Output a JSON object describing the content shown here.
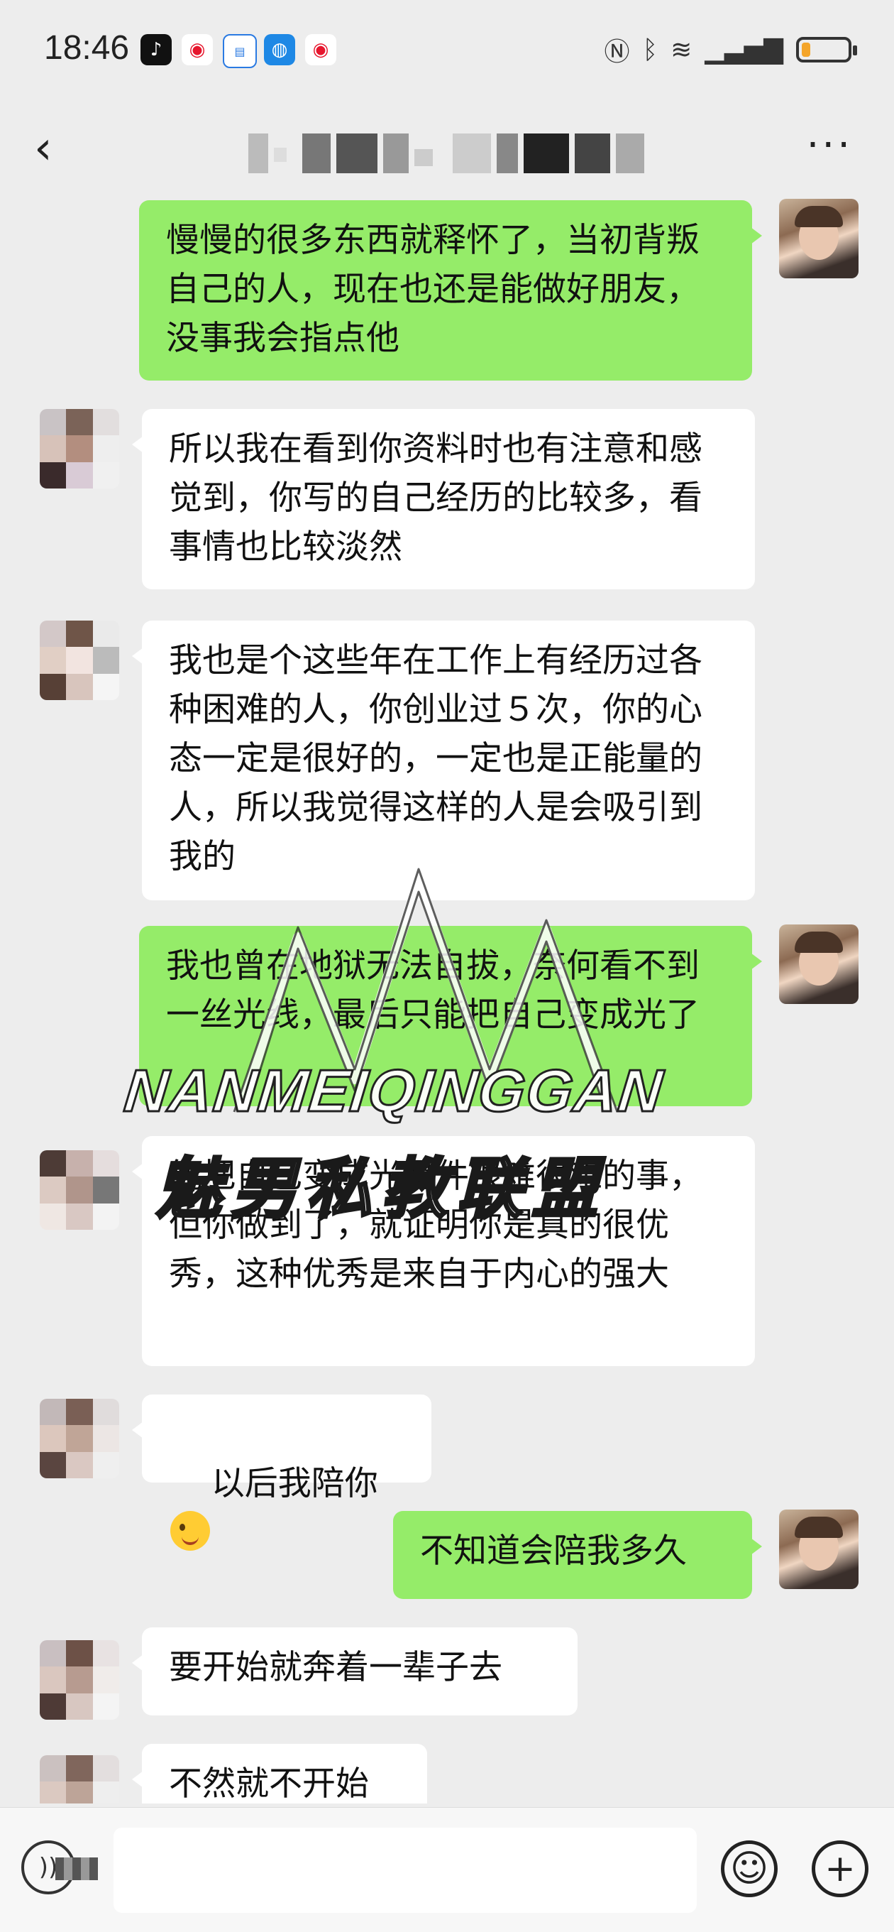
{
  "status_bar": {
    "time": "18:46",
    "app_icons": [
      "tiktok-icon",
      "weibo-icon",
      "news-app-icon",
      "browser-icon",
      "weibo-icon"
    ],
    "right_icons": [
      "nfc-icon",
      "bluetooth-icon",
      "wifi-icon",
      "signal-icon"
    ],
    "battery_level_percent": 20,
    "battery_color": "#f4a52a"
  },
  "header": {
    "back_glyph": "‹",
    "more_glyph": "···"
  },
  "colors": {
    "my_bubble": "#95ec69",
    "other_bubble": "#ffffff",
    "background": "#ededed"
  },
  "messages": [
    {
      "side": "me",
      "text": "慢慢的很多东西就释怀了，当初背叛自己的人，现在也还是能做好朋友，没事我会指点他"
    },
    {
      "side": "other",
      "text": "所以我在看到你资料时也有注意和感觉到，你写的自己经历的比较多，看事情也比较淡然"
    },
    {
      "side": "other",
      "text": "我也是个这些年在工作上有经历过各种困难的人，你创业过５次，你的心态一定是很好的，一定也是正能量的人，所以我觉得这样的人是会吸引到我的"
    },
    {
      "side": "me",
      "text": "我也曾在地狱无法自拔，奈何看不到一丝光线，最后只能把自己变成光了"
    },
    {
      "side": "other",
      "text": "能把自己变成光是件很难很难的事，但你做到了，就证明你是真的很优秀，这种优秀是来自于内心的强大"
    },
    {
      "side": "other",
      "text": "以后我陪你",
      "emoji": "winking-face-with-tongue-emoji"
    },
    {
      "side": "me",
      "text": "不知道会陪我多久"
    },
    {
      "side": "other",
      "text": "要开始就奔着一辈子去"
    },
    {
      "side": "other",
      "text": "不然就不开始"
    }
  ],
  "watermark": {
    "latin": "NANMEIQINGGAN",
    "chinese": "魅男私教联盟"
  },
  "input_bar": {
    "voice_glyph": "))",
    "emoji_glyph": "☺",
    "plus_glyph": "+"
  }
}
